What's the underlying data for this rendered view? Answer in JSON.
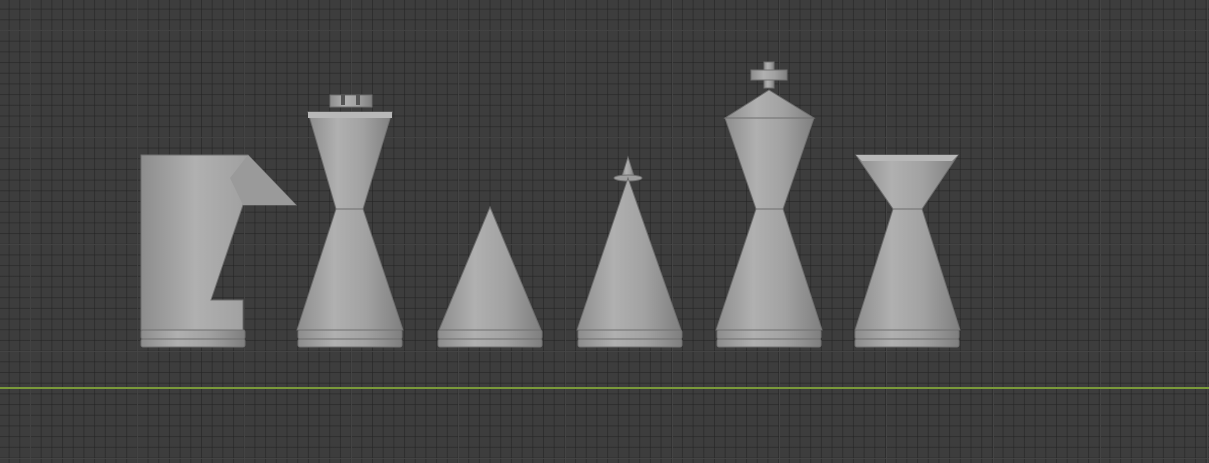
{
  "viewport": {
    "background_color": "#3d3d3d",
    "grid_major_color": "#474747",
    "grid_minor_color": "#363636",
    "x_axis_color": "#7a9a3a",
    "view": "front-orthographic"
  },
  "scene": {
    "material_color": "#a6a6a6",
    "objects": [
      {
        "name": "knight"
      },
      {
        "name": "rook"
      },
      {
        "name": "pawn"
      },
      {
        "name": "bishop"
      },
      {
        "name": "king"
      },
      {
        "name": "queen"
      }
    ]
  }
}
